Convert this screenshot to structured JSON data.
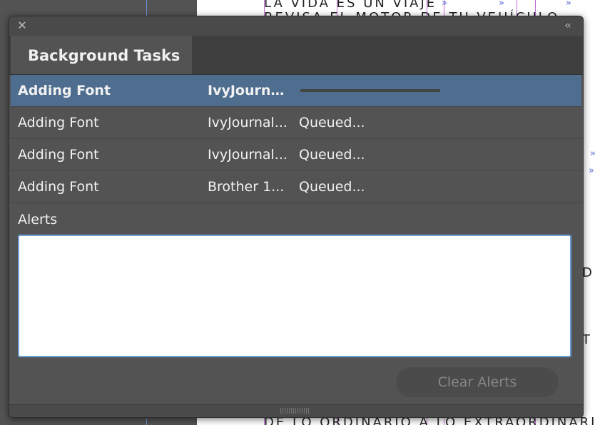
{
  "background_document": {
    "top_line": "LA VIDA ES UN VIAJE",
    "second_line": "REVISA EL MOTOR DE TU VEHÍCULO",
    "bottom_line": "DE LO ORDINARIO A LO EXTRAORDINARIO",
    "edge_fragment_1": "D",
    "edge_fragment_2": "T",
    "marker": "»"
  },
  "panel": {
    "close_glyph": "✕",
    "collapse_glyph": "‹‹",
    "tab_title": "Background Tasks",
    "tasks": [
      {
        "action": "Adding Font",
        "font": "IvyJourna...",
        "status": "",
        "progress": 1.0,
        "selected": true
      },
      {
        "action": "Adding Font",
        "font": "IvyJournal...",
        "status": "Queued...",
        "selected": false
      },
      {
        "action": "Adding Font",
        "font": "IvyJournal...",
        "status": "Queued...",
        "selected": false
      },
      {
        "action": "Adding Font",
        "font": "Brother 1...",
        "status": "Queued...",
        "selected": false
      }
    ],
    "alerts_label": "Alerts",
    "alerts_text": "",
    "clear_button_label": "Clear Alerts",
    "icons": {
      "close": "close-icon",
      "collapse": "double-chevron-left-icon",
      "resize": "resize-grip-icon"
    },
    "colors": {
      "selected_row": "#4e6d8f",
      "alerts_focus_border": "#6c9ed8",
      "panel_background": "#535353"
    }
  }
}
